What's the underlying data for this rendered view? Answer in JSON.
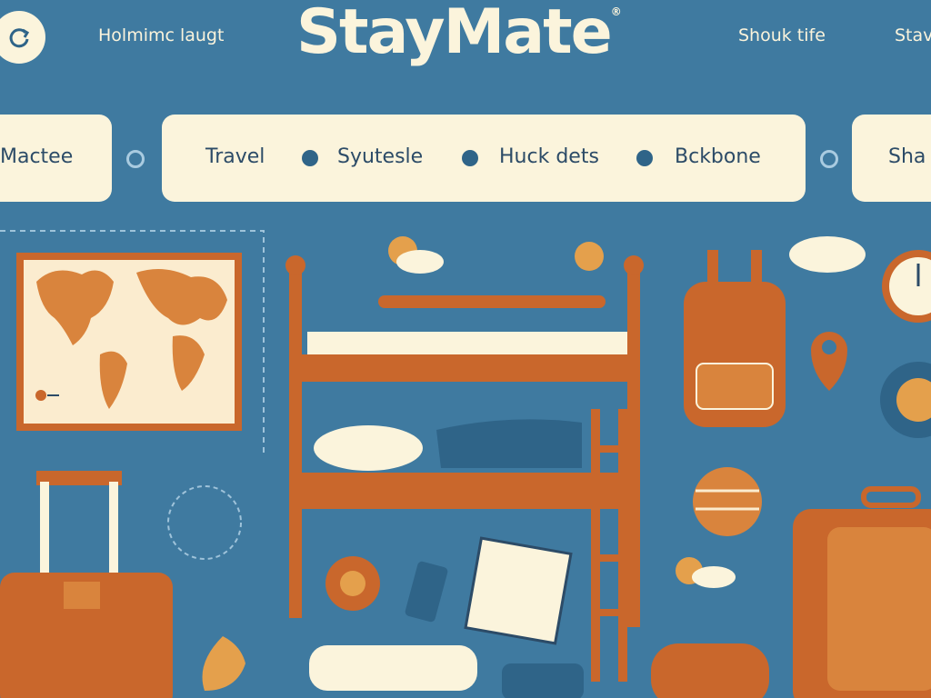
{
  "header": {
    "brand": "StayMate",
    "trademark": "®",
    "links": [
      "Holmimc laugt",
      "Shouk tife",
      "Stav"
    ]
  },
  "nav": {
    "left_pill": "Mactee",
    "items": [
      "Travel",
      "Syutesle",
      "Huck dets",
      "Bckbone"
    ],
    "right_pill": "Sha"
  },
  "colors": {
    "background": "#3f7aa0",
    "cream": "#fbf4dc",
    "accent_orange": "#c9672c",
    "nav_text": "#2c4b67"
  }
}
